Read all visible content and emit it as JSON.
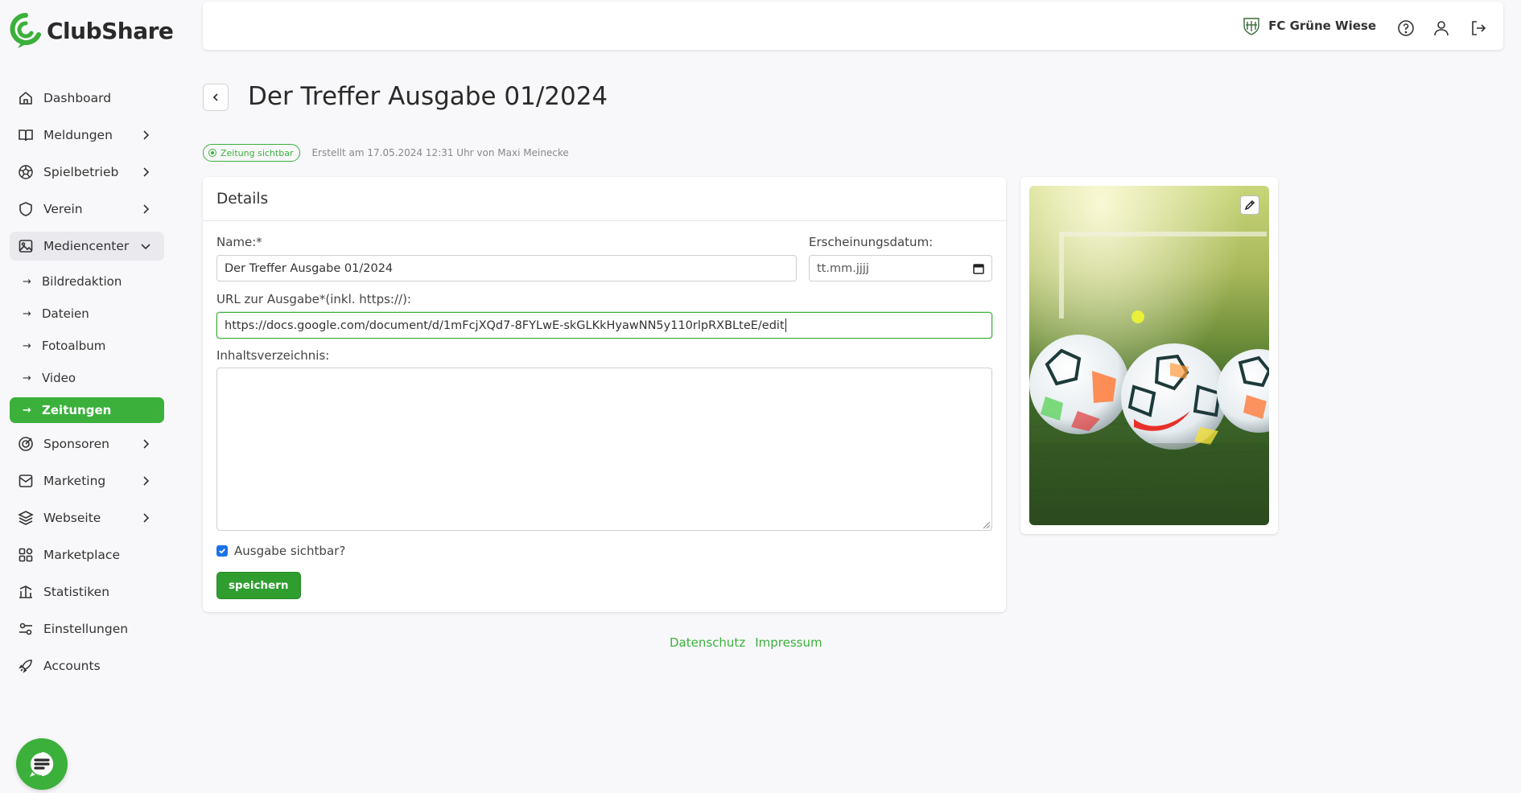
{
  "app": {
    "name": "ClubShare"
  },
  "colors": {
    "accent": "#3bb03b",
    "accent_dark": "#2f9e2f",
    "checkbox": "#1a73e8"
  },
  "sidebar": {
    "items": [
      {
        "label": "Dashboard",
        "icon": "home-icon"
      },
      {
        "label": "Meldungen",
        "icon": "book-icon",
        "has_children": true
      },
      {
        "label": "Spielbetrieb",
        "icon": "soccer-ball-icon",
        "has_children": true
      },
      {
        "label": "Verein",
        "icon": "shield-icon",
        "has_children": true
      },
      {
        "label": "Mediencenter",
        "icon": "image-icon",
        "expanded": true,
        "children": [
          {
            "label": "Bildredaktion"
          },
          {
            "label": "Dateien"
          },
          {
            "label": "Fotoalbum"
          },
          {
            "label": "Video"
          },
          {
            "label": "Zeitungen",
            "active": true
          }
        ]
      },
      {
        "label": "Sponsoren",
        "icon": "target-icon",
        "has_children": true
      },
      {
        "label": "Marketing",
        "icon": "mail-icon",
        "has_children": true
      },
      {
        "label": "Webseite",
        "icon": "layers-icon",
        "has_children": true
      },
      {
        "label": "Marketplace",
        "icon": "grid-icon"
      },
      {
        "label": "Statistiken",
        "icon": "chart-icon"
      },
      {
        "label": "Einstellungen",
        "icon": "sliders-icon"
      },
      {
        "label": "Accounts",
        "icon": "rocket-icon"
      }
    ]
  },
  "topbar": {
    "club_name": "FC Grüne Wiese"
  },
  "page": {
    "title": "Der Treffer Ausgabe 01/2024",
    "badge": "Zeitung sichtbar",
    "meta": "Erstellt am 17.05.2024 12:31 Uhr von Maxi Meinecke"
  },
  "details": {
    "heading": "Details",
    "name_label": "Name:*",
    "name_value": "Der Treffer Ausgabe 01/2024",
    "date_label": "Erscheinungsdatum:",
    "date_placeholder": "tt.mm.jjjj",
    "url_label": "URL zur Ausgabe*(inkl. https://):",
    "url_value": "https://docs.google.com/document/d/1mFcjXQd7-8FYLwE-skGLKkHyawNN5y110rlpRXBLteE/edit",
    "toc_label": "Inhaltsverzeichnis:",
    "toc_value": "",
    "visible_label": "Ausgabe sichtbar?",
    "visible_checked": true,
    "save_label": "speichern"
  },
  "footer": {
    "privacy": "Datenschutz",
    "imprint": "Impressum"
  }
}
